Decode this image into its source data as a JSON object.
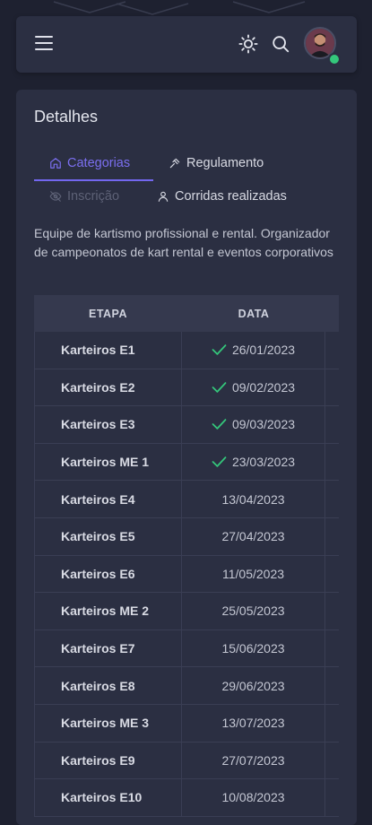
{
  "card": {
    "title": "Detalhes",
    "tabs": [
      {
        "label": "Categorias",
        "icon": "home-icon",
        "state": "active"
      },
      {
        "label": "Regulamento",
        "icon": "gavel-icon",
        "state": "normal"
      },
      {
        "label": "Inscrição",
        "icon": "eye-off-icon",
        "state": "disabled"
      },
      {
        "label": "Corridas realizadas",
        "icon": "user-icon",
        "state": "normal"
      }
    ],
    "description": "Equipe de kartismo profissional e rental. Organizador de campeonatos de kart rental e eventos corporativos"
  },
  "table": {
    "headers": [
      "ETAPA",
      "DATA"
    ],
    "rows": [
      {
        "etapa": "Karteiros E1",
        "data": "26/01/2023",
        "done": true
      },
      {
        "etapa": "Karteiros E2",
        "data": "09/02/2023",
        "done": true
      },
      {
        "etapa": "Karteiros E3",
        "data": "09/03/2023",
        "done": true
      },
      {
        "etapa": "Karteiros ME 1",
        "data": "23/03/2023",
        "done": true
      },
      {
        "etapa": "Karteiros E4",
        "data": "13/04/2023",
        "done": false
      },
      {
        "etapa": "Karteiros E5",
        "data": "27/04/2023",
        "done": false
      },
      {
        "etapa": "Karteiros E6",
        "data": "11/05/2023",
        "done": false
      },
      {
        "etapa": "Karteiros ME 2",
        "data": "25/05/2023",
        "done": false
      },
      {
        "etapa": "Karteiros E7",
        "data": "15/06/2023",
        "done": false
      },
      {
        "etapa": "Karteiros E8",
        "data": "29/06/2023",
        "done": false
      },
      {
        "etapa": "Karteiros ME 3",
        "data": "13/07/2023",
        "done": false
      },
      {
        "etapa": "Karteiros E9",
        "data": "27/07/2023",
        "done": false
      },
      {
        "etapa": "Karteiros E10",
        "data": "10/08/2023",
        "done": false
      }
    ]
  },
  "colors": {
    "accent": "#7367f0",
    "check": "#34c77b",
    "background": "#1e2130",
    "card": "#2b2f42"
  }
}
